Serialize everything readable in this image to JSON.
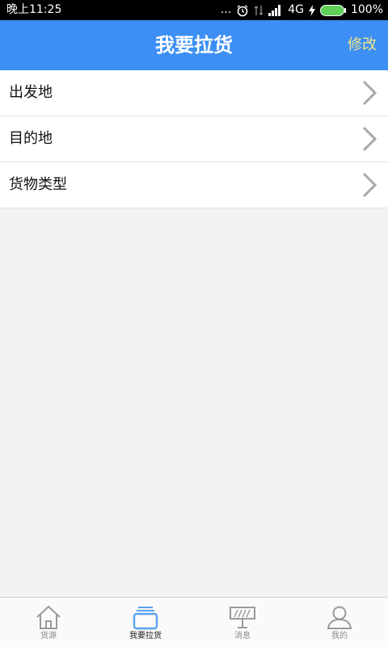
{
  "status_bar": {
    "time": "晚上11:25",
    "dots": "...",
    "network": "4G",
    "battery": "100%"
  },
  "header": {
    "title": "我要拉货",
    "action_label": "修改"
  },
  "list": {
    "items": [
      {
        "label": "出发地",
        "icon": "chevron-right-icon"
      },
      {
        "label": "目的地",
        "icon": "chevron-right-icon"
      },
      {
        "label": "货物类型",
        "icon": "chevron-right-icon"
      }
    ]
  },
  "bottom_nav": {
    "items": [
      {
        "label": "货源",
        "icon": "home-icon",
        "active": false
      },
      {
        "label": "我要拉货",
        "icon": "cargo-icon",
        "active": true
      },
      {
        "label": "消息",
        "icon": "message-board-icon",
        "active": false
      },
      {
        "label": "我的",
        "icon": "user-icon",
        "active": false
      }
    ]
  },
  "colors": {
    "header_bg": "#3d8ff5",
    "action_text": "#f3e58a",
    "active_icon": "#5aa2f0",
    "inactive_icon": "#9a9a9a"
  }
}
